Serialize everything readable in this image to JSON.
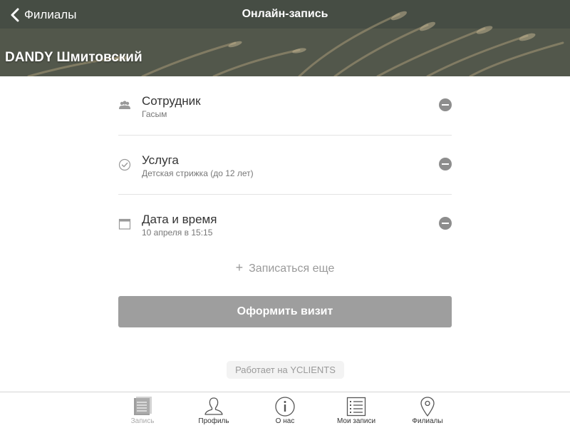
{
  "header": {
    "back_label": "Филиалы",
    "title": "Онлайн-запись",
    "company_name": "DANDY Шмитовский"
  },
  "booking": {
    "items": [
      {
        "icon": "team-icon",
        "title": "Сотрудник",
        "subtitle": "Гасым"
      },
      {
        "icon": "check-circle-icon",
        "title": "Услуга",
        "subtitle": "Детская стрижка (до 12 лет)"
      },
      {
        "icon": "calendar-icon",
        "title": "Дата и время",
        "subtitle": "10 апреля в 15:15"
      }
    ],
    "add_more_label": "Записаться еще",
    "submit_label": "Оформить визит"
  },
  "footer": {
    "powered_by": "Работает на YCLIENTS"
  },
  "tabbar": {
    "tabs": [
      {
        "label": "Запись",
        "icon": "list-doc-icon",
        "active": true
      },
      {
        "label": "Профиль",
        "icon": "user-icon",
        "active": false
      },
      {
        "label": "О нас",
        "icon": "info-icon",
        "active": false
      },
      {
        "label": "Мои записи",
        "icon": "checklist-icon",
        "active": false
      },
      {
        "label": "Филиалы",
        "icon": "map-pin-icon",
        "active": false
      }
    ]
  },
  "colors": {
    "button_bg": "#9e9e9e",
    "remove_bg": "#8d8d8d",
    "active_tab_label": "#aaaaaa"
  }
}
